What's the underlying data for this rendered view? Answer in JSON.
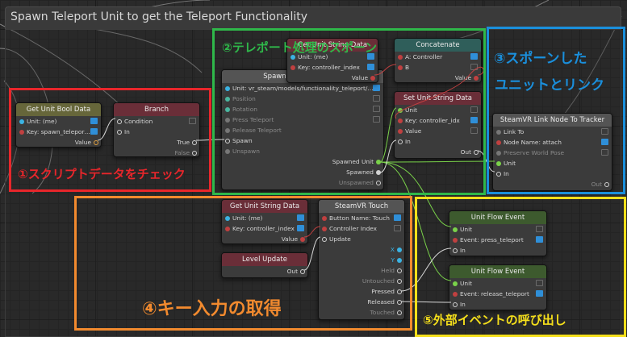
{
  "group": {
    "title": "Spawn Teleport Unit to get the Teleport Functionality"
  },
  "nodes": {
    "get_bool": {
      "title": "Get Unit Bool Data",
      "unit": "Unit: (me)",
      "key": "Key: spawn_telepor…",
      "value": "Value"
    },
    "branch": {
      "title": "Branch",
      "condition": "Condition",
      "in": "In",
      "true": "True",
      "false": "False"
    },
    "spawn": {
      "title": "Spawn Unit on Position",
      "unit": "Unit: vr_steam/models/functionality_teleport/…",
      "position": "Position",
      "rotation": "Rotation",
      "press": "Press Teleport",
      "release": "Release Teleport",
      "spawn": "Spawn",
      "unspawn": "Unspawn",
      "spawned_unit": "Spawned Unit",
      "spawned": "Spawned",
      "unspawned": "Unspawned"
    },
    "get_string_top": {
      "title": "Get Unit String Data",
      "unit": "Unit: (me)",
      "key": "Key: controller_index",
      "value": "Value"
    },
    "concat": {
      "title": "Concatenate",
      "a": "A: Controller",
      "b": "B",
      "value": "Value"
    },
    "set_string": {
      "title": "Set Unit String Data",
      "unit": "Unit",
      "key": "Key: controller_idx",
      "value": "Value",
      "in": "In",
      "out": "Out"
    },
    "link_node": {
      "title": "SteamVR Link Node To Tracker",
      "link_to": "Link To",
      "node_name": "Node Name: attach",
      "preserve": "Preserve World Pose",
      "unit": "Unit",
      "in": "In",
      "out": "Out"
    },
    "get_string_bottom": {
      "title": "Get Unit String Data",
      "unit": "Unit: (me)",
      "key": "Key: controller_index",
      "value": "Value"
    },
    "level_update": {
      "title": "Level Update",
      "out": "Out"
    },
    "touch": {
      "title": "SteamVR Touch",
      "button": "Button Name: Touch",
      "controller": "Controller Index",
      "update": "Update",
      "x": "X",
      "y": "Y",
      "held": "Held",
      "untouched": "Untouched",
      "pressed": "Pressed",
      "released": "Released",
      "touched": "Touched"
    },
    "flow_press": {
      "title": "Unit Flow Event",
      "unit": "Unit",
      "event": "Event: press_teleport",
      "in": "In"
    },
    "flow_release": {
      "title": "Unit Flow Event",
      "unit": "Unit",
      "event": "Event: release_teleport",
      "in": "In"
    }
  },
  "callouts": {
    "c1": {
      "label": "①スクリプトデータをチェック",
      "color": "#e8262b"
    },
    "c2": {
      "label": "②テレポート処理のスポーン",
      "color": "#2fb84a"
    },
    "c3a": {
      "label": "③スポーンした",
      "color": "#1a8fdc"
    },
    "c3b": {
      "label": "ユニットとリンク",
      "color": "#1a8fdc"
    },
    "c4": {
      "label": "④キー入力の取得",
      "color": "#f28a2e"
    },
    "c5": {
      "label": "⑤外部イベントの呼び出し",
      "color": "#f5df1b"
    }
  }
}
